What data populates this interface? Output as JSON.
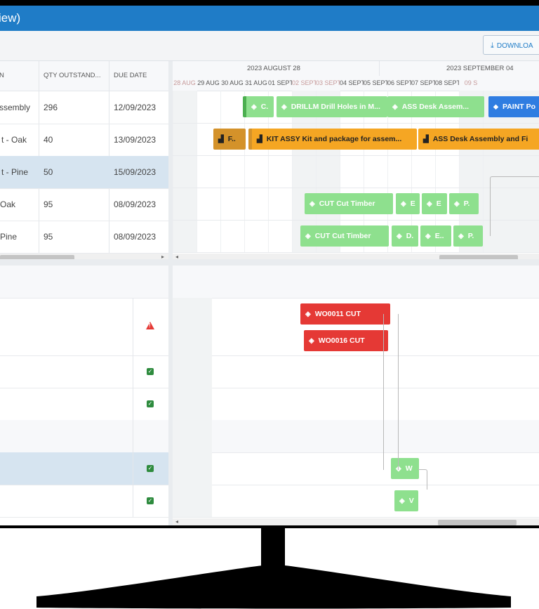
{
  "window": {
    "title": "iew)"
  },
  "toolbar": {
    "download_label": "DOWNLOA"
  },
  "left_grid": {
    "headers": [
      "N",
      "QTY OUTSTAND...",
      "DUE DATE"
    ],
    "rows": [
      {
        "name": "ssembly",
        "qty": "296",
        "due": "12/09/2023"
      },
      {
        "name": "t - Oak",
        "qty": "40",
        "due": "13/09/2023"
      },
      {
        "name": "t - Pine",
        "qty": "50",
        "due": "15/09/2023"
      },
      {
        "name": "Oak",
        "qty": "95",
        "due": "08/09/2023"
      },
      {
        "name": "Pine",
        "qty": "95",
        "due": "08/09/2023"
      }
    ]
  },
  "gantt": {
    "weeks": [
      "2023 AUGUST 28",
      "2023 SEPTEMBER 04"
    ],
    "days": [
      "28 AUG",
      "29 AUG",
      "30 AUG",
      "31 AUG",
      "01 SEPT",
      "02 SEPT",
      "03 SEPT",
      "04 SEPT",
      "05 SEPT",
      "06 SEPT",
      "07 SEPT",
      "08 SEPT",
      "09 S"
    ],
    "bars": {
      "r1_c": "C.",
      "r1_drill": "DRILLM Drill Holes in M...",
      "r1_ass": "ASS Desk Assem...",
      "r1_paint": "PAINT Po",
      "r2_f": "F..",
      "r2_kit": "KIT ASSY Kit and package for assem...",
      "r2_ass": "ASS Desk Assembly and Fi",
      "r4_cut": "CUT Cut Timber",
      "r4_b": "E",
      "r4_c": "E",
      "r4_d": "P.",
      "r5_cut": "CUT Cut Timber",
      "r5_b": "D.",
      "r5_c": "E..",
      "r5_d": "P."
    }
  },
  "lower_gantt": {
    "bars": {
      "wo11": "WO0011 CUT",
      "wo16": "WO0016 CUT",
      "w1": "W",
      "w2": "V"
    }
  },
  "colors": {
    "accent": "#1f7cc7",
    "green_op": "#8ee08e",
    "orange_op": "#f5a623",
    "blue_op": "#2f7de1",
    "red_op": "#e53935"
  }
}
